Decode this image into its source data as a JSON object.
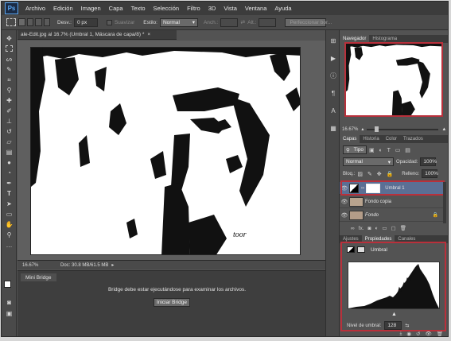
{
  "app": {
    "logo": "Ps"
  },
  "menu": [
    "Archivo",
    "Edición",
    "Imagen",
    "Capa",
    "Texto",
    "Selección",
    "Filtro",
    "3D",
    "Vista",
    "Ventana",
    "Ayuda"
  ],
  "options_bar": {
    "desv_label": "Desv.:",
    "desv_value": "0 px",
    "suavizar_label": "Suavizar",
    "estilo_label": "Estilo:",
    "estilo_value": "Normal",
    "anch_label": "Anch.:",
    "alt_label": "Alt.:",
    "perfeccionar_label": "Perfeccionar bor..."
  },
  "document": {
    "tab_title": "ale-Edit.jpg al 16.7% (Umbral 1, Máscara de capa/8) *",
    "zoom": "16.67%",
    "doc_info": "Doc: 30.8 MB/61.5 MB",
    "watermark": "toor"
  },
  "mini_bridge": {
    "tab": "Mini Bridge",
    "message": "Bridge debe estar ejecutándose para examinar los archivos.",
    "button": "Iniciar Bridge"
  },
  "navigator": {
    "tabs": [
      "Navegador",
      "Histograma"
    ],
    "zoom": "16.67%"
  },
  "layers_panel": {
    "tabs": [
      "Capas",
      "Historia",
      "Color",
      "Trazados"
    ],
    "kind_filter": "Tipo",
    "blend_mode": "Normal",
    "opacity_label": "Opacidad:",
    "opacity_value": "100%",
    "lock_label": "Bloq.:",
    "fill_label": "Relleno:",
    "fill_value": "100%",
    "layers": [
      {
        "name": "Umbral 1",
        "selected": true
      },
      {
        "name": "Fondo copia",
        "selected": false
      },
      {
        "name": "Fondo",
        "selected": false
      }
    ],
    "footer_fx": "fx."
  },
  "properties_panel": {
    "tabs": [
      "Ajustes",
      "Propiedades",
      "Canales"
    ],
    "title": "Umbral",
    "threshold_label": "Nivel de umbral:",
    "threshold_value": "128"
  },
  "colors": {
    "accent_red": "#b9303b",
    "selected_layer": "#5b6f94"
  }
}
